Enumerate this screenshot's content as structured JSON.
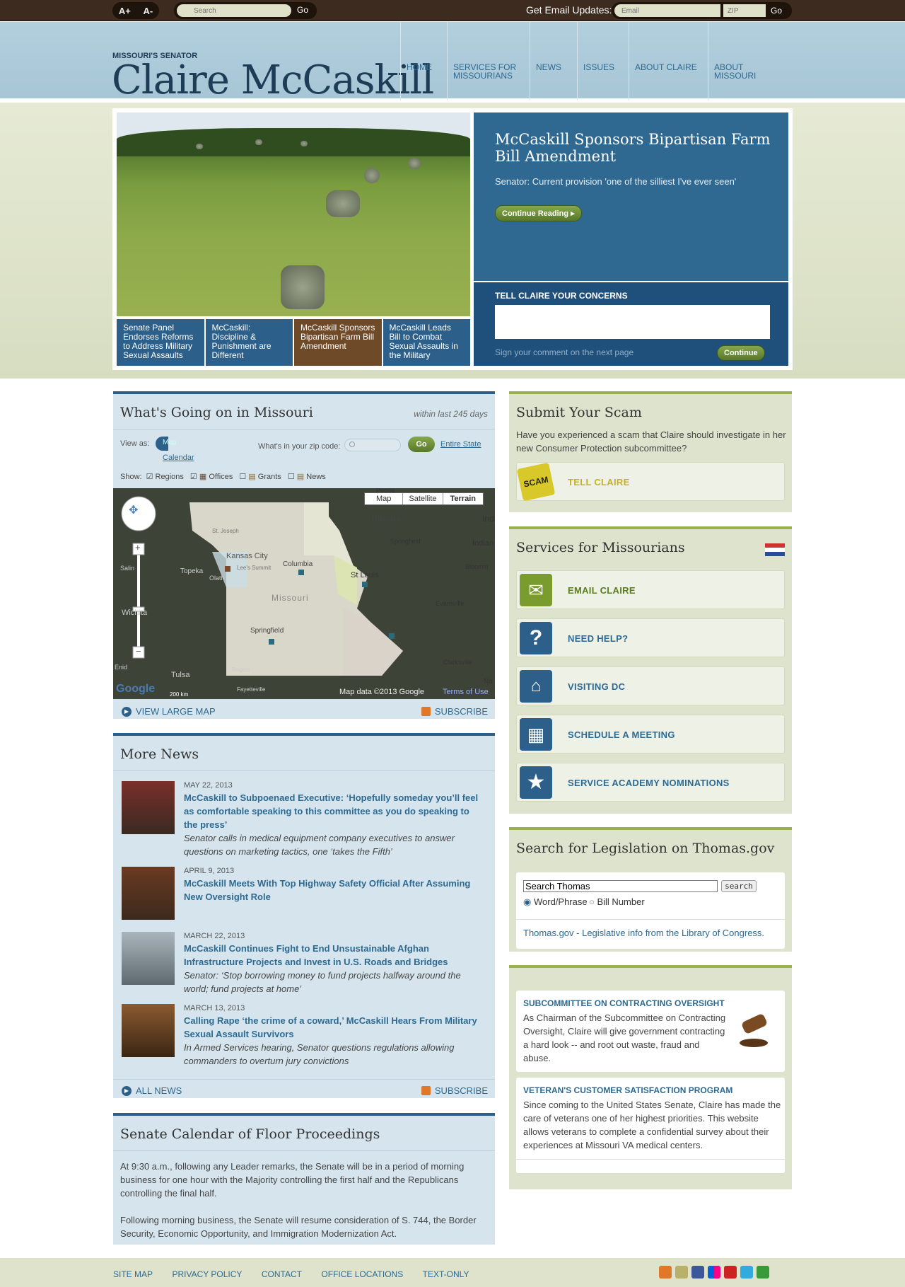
{
  "topbar": {
    "font_up": "A+",
    "font_down": "A-",
    "search_placeholder": "Search",
    "go_label": "Go",
    "email_updates_label": "Get Email Updates:",
    "email_placeholder": "Email",
    "zip_placeholder": "ZIP"
  },
  "header": {
    "kicker": "MISSOURI'S SENATOR",
    "name": "Claire McCaskill",
    "nav": [
      "HOME",
      "SERVICES FOR MISSOURIANS",
      "NEWS",
      "ISSUES",
      "ABOUT CLAIRE",
      "ABOUT MISSOURI"
    ]
  },
  "hero": {
    "headline": "McCaskill Sponsors Bipartisan Farm Bill Amendment",
    "summary": "Senator: Current provision 'one of the silliest I've ever seen'",
    "continue_reading": "Continue Reading",
    "tabs": [
      "Senate Panel Endorses Reforms to Address Military Sexual Assaults",
      "McCaskill: Discipline & Punishment are Different",
      "McCaskill Sponsors Bipartisan Farm Bill Amendment",
      "McCaskill Leads Bill to Combat Sexual Assaults in the Military"
    ],
    "active_tab": 2,
    "concerns_title": "TELL CLAIRE YOUR CONCERNS",
    "concerns_hint": "Sign your comment on the next page",
    "continue": "Continue"
  },
  "missouri": {
    "title": "What's Going on in Missouri",
    "within": "within last 245 days",
    "view_as": "View as:",
    "map_option": "Map",
    "calendar_option": "Calendar",
    "zip_label": "What's in your zip code:",
    "go": "Go",
    "entire_state": "Entire State",
    "show_label": "Show:",
    "filters": [
      {
        "label": "Regions",
        "checked": true
      },
      {
        "label": "Offices",
        "checked": true
      },
      {
        "label": "Grants",
        "checked": false
      },
      {
        "label": "News",
        "checked": false
      }
    ],
    "map_types": [
      "Map",
      "Satellite",
      "Terrain"
    ],
    "selected_map_type": "Terrain",
    "map_labels": [
      "Illinois",
      "Springfield",
      "Indian",
      "Salin",
      "Topeka",
      "Kansas City",
      "Lee's Summit",
      "Olath",
      "Columbia",
      "St Louis",
      "Missouri",
      "Evansville",
      "Bloomin",
      "Wichita",
      "Springfield",
      "Clarksville",
      "Enid",
      "Tulsa",
      "Rogers",
      "Fayetteville",
      "St. Joseph",
      "Peoria",
      "Na",
      "Ind"
    ],
    "map_attribution": "Map data ©2013 Google",
    "terms": "Terms of Use",
    "scale": "200 km",
    "google": "Google",
    "view_large_map": "VIEW LARGE MAP",
    "subscribe": "SUBSCRIBE"
  },
  "more_news": {
    "title": "More News",
    "items": [
      {
        "date": "MAY 22, 2013",
        "title": "McCaskill to Subpoenaed Executive: ‘Hopefully someday you’ll feel as comfortable speaking to this committee as you do speaking to the press’",
        "summary": "Senator calls in medical equipment company executives to answer questions on marketing tactics, one ‘takes the Fifth’"
      },
      {
        "date": "APRIL 9, 2013",
        "title": "McCaskill Meets With Top Highway Safety Official After Assuming New Oversight Role",
        "summary": ""
      },
      {
        "date": "MARCH 22, 2013",
        "title": "McCaskill Continues Fight to End Unsustainable Afghan Infrastructure Projects and Invest in U.S. Roads and Bridges",
        "summary": "Senator: ‘Stop borrowing money to fund projects halfway around the world; fund projects at home’"
      },
      {
        "date": "MARCH 13, 2013",
        "title": "Calling Rape ‘the crime of a coward,’ McCaskill Hears From Military Sexual Assault Survivors",
        "summary": "In Armed Services hearing, Senator questions regulations allowing commanders to overturn jury convictions"
      }
    ],
    "all_news": "ALL NEWS",
    "subscribe": "SUBSCRIBE"
  },
  "calendar": {
    "title": "Senate Calendar of Floor Proceedings",
    "p1": "At 9:30 a.m., following any Leader remarks, the Senate will be in a period of morning business for one hour with the Majority controlling the first half and the Republicans controlling the final half.",
    "p2": "Following morning business, the Senate will resume consideration of S. 744, the Border Security, Economic Opportunity, and Immigration Modernization Act."
  },
  "scam": {
    "title": "Submit Your Scam",
    "text": "Have you experienced a scam that Claire should investigate in her new Consumer Protection subcommittee?",
    "badge": "SCAM",
    "button": "TELL CLAIRE"
  },
  "services": {
    "title": "Services for Missourians",
    "items": [
      "EMAIL CLAIRE",
      "NEED HELP?",
      "VISITING DC",
      "SCHEDULE A MEETING",
      "SERVICE ACADEMY NOMINATIONS"
    ]
  },
  "thomas": {
    "title": "Search for Legislation on Thomas.gov",
    "input_value": "Search Thomas",
    "search_button": "search",
    "opt1": "Word/Phrase",
    "opt2": "Bill Number",
    "link": "Thomas.gov - Legislative info from the Library of Congress."
  },
  "features": [
    {
      "title": "SUBCOMMITTEE ON CONTRACTING OVERSIGHT",
      "text": "As Chairman of the Subcommittee on Contracting Oversight, Claire will give government contracting a hard look -- and root out waste, fraud and abuse."
    },
    {
      "title": "VETERAN'S CUSTOMER SATISFACTION PROGRAM",
      "text": "Since coming to the United States Senate, Claire has made the care of veterans one of her highest priorities. This website allows veterans to complete a confidential survey about their experiences at Missouri VA medical centers."
    }
  ],
  "footer": {
    "links": [
      "SITE MAP",
      "PRIVACY POLICY",
      "CONTACT",
      "OFFICE LOCATIONS",
      "TEXT-ONLY"
    ],
    "social_icons": [
      "rss-icon",
      "email-icon",
      "facebook-icon",
      "flickr-icon",
      "youtube-icon",
      "twitter-icon",
      "share-icon"
    ]
  }
}
